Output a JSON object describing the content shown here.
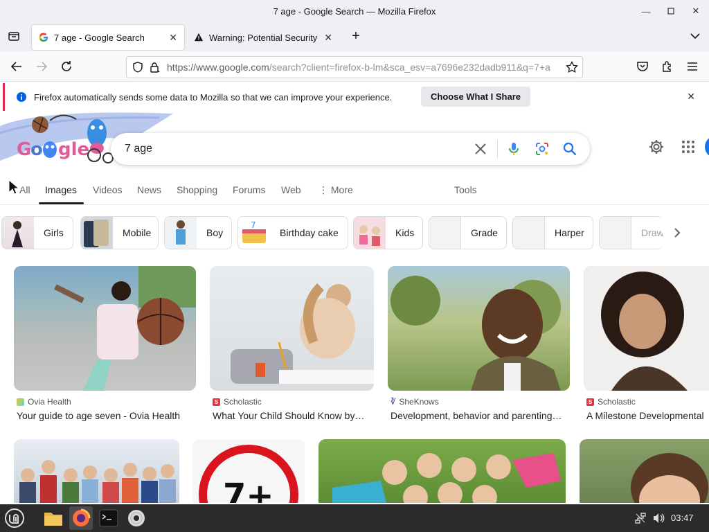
{
  "window": {
    "title": "7 age - Google Search — Mozilla Firefox"
  },
  "tabs": [
    {
      "label": "7 age - Google Search"
    },
    {
      "label": "Warning: Potential Security"
    }
  ],
  "url": {
    "host": "https://www.google.com",
    "path": "/search?client=firefox-b-lm&sca_esv=a7696e232dadb911&q=7+a"
  },
  "notification": {
    "text": "Firefox automatically sends some data to Mozilla so that we can improve your experience.",
    "button": "Choose What I Share"
  },
  "search": {
    "query": "7 age"
  },
  "google_tabs": [
    "All",
    "Images",
    "Videos",
    "News",
    "Shopping",
    "Forums",
    "Web",
    "More",
    "Tools"
  ],
  "chips": [
    "Girls",
    "Mobile",
    "Boy",
    "Birthday cake",
    "Kids",
    "Grade",
    "Harper",
    "Draw"
  ],
  "results": [
    {
      "source": "Ovia Health",
      "caption": "Your guide to age seven - Ovia Health"
    },
    {
      "source": "Scholastic",
      "caption": "What Your Child Should Know by…"
    },
    {
      "source": "SheKnows",
      "caption": "Development, behavior and parenting…"
    },
    {
      "source": "Scholastic",
      "caption": "A Milestone Developmental"
    }
  ],
  "taskbar": {
    "clock": "03:47"
  },
  "colors": {
    "accent": "#1a73e8",
    "notif_border": "#e22850",
    "taskbar": "#2b2b2b"
  }
}
